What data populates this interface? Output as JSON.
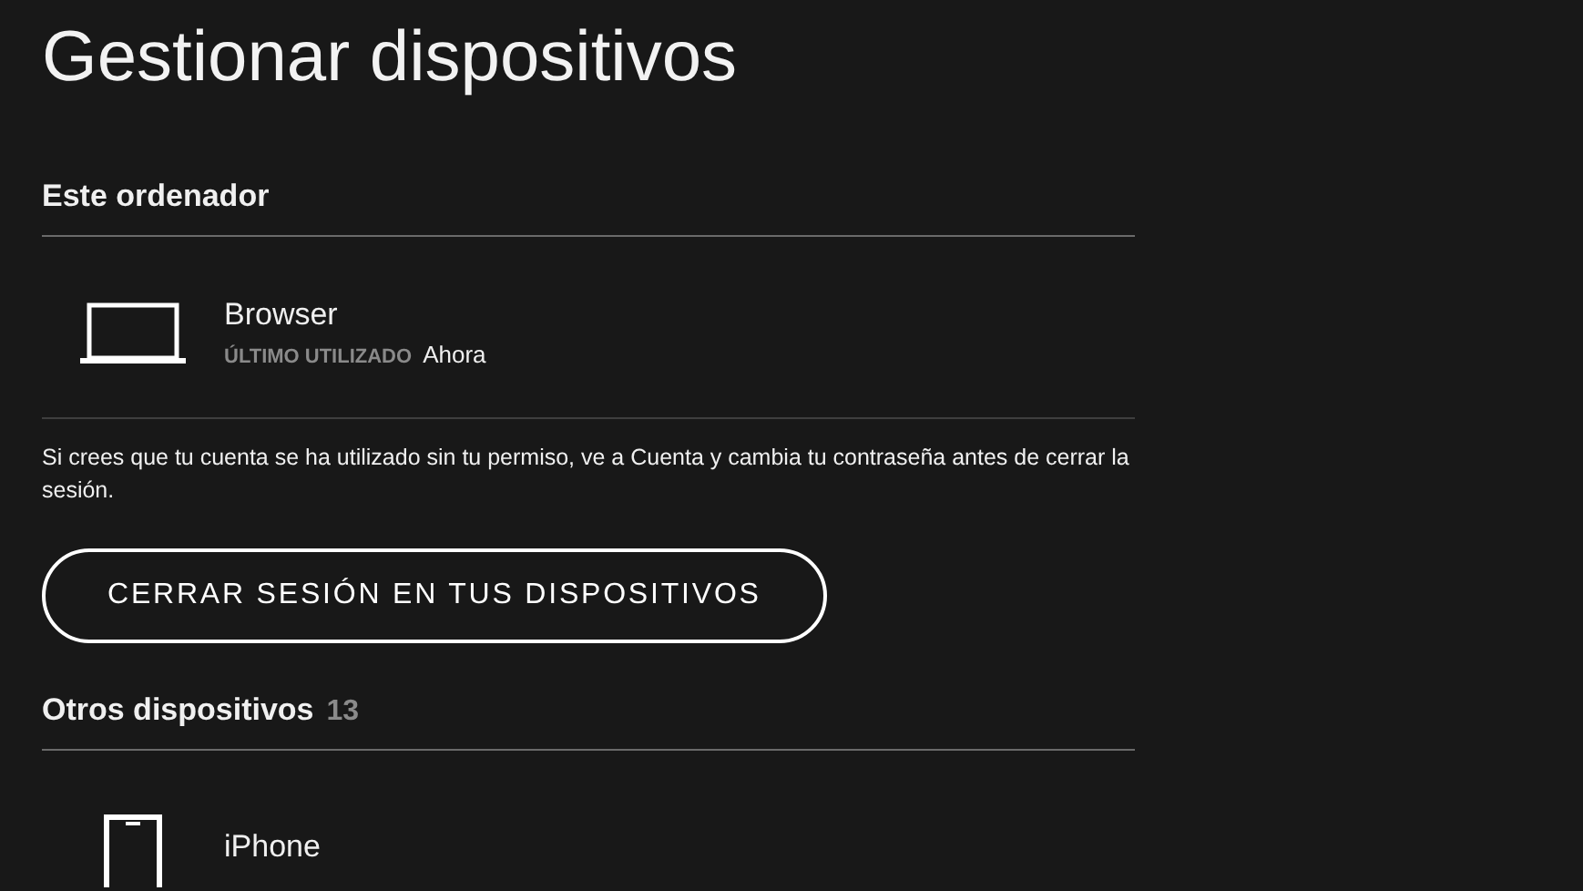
{
  "title": "Gestionar dispositivos",
  "this_computer": {
    "heading": "Este ordenador",
    "device": {
      "kind": "laptop",
      "name": "Browser",
      "last_used_label": "ÚLTIMO UTILIZADO",
      "last_used": "Ahora"
    }
  },
  "notice": "Si crees que tu cuenta se ha utilizado sin tu permiso, ve a Cuenta y cambia tu contraseña antes de cerrar la sesión.",
  "sign_out_button": "CERRAR SESIÓN EN TUS DISPOSITIVOS",
  "other_devices": {
    "heading": "Otros dispositivos",
    "count": "13",
    "devices": [
      {
        "kind": "phone",
        "name": "iPhone"
      }
    ]
  }
}
